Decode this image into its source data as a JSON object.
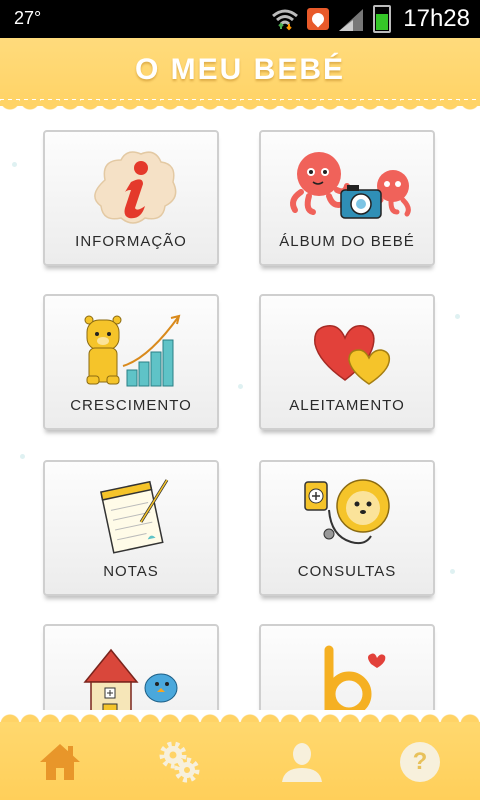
{
  "status_bar": {
    "temperature": "27°",
    "time": "17h28",
    "icons": [
      "wifi-icon",
      "notification-icon",
      "signal-icon",
      "battery-icon"
    ]
  },
  "header": {
    "title": "O MEU BEBÉ"
  },
  "tiles": [
    {
      "label": "INFORMAÇÃO",
      "icon": "info-icon"
    },
    {
      "label": "ÁLBUM DO BEBÉ",
      "icon": "octopus-camera-icon"
    },
    {
      "label": "CRESCIMENTO",
      "icon": "growth-chart-icon"
    },
    {
      "label": "ALEITAMENTO",
      "icon": "hearts-icon"
    },
    {
      "label": "NOTAS",
      "icon": "notepad-icon"
    },
    {
      "label": "CONSULTAS",
      "icon": "lion-doctor-icon"
    },
    {
      "label": "",
      "icon": "house-bird-icon"
    },
    {
      "label": "",
      "icon": "b-logo-icon"
    }
  ],
  "bottom_nav": [
    {
      "name": "home",
      "icon": "home-icon"
    },
    {
      "name": "settings",
      "icon": "gears-icon"
    },
    {
      "name": "profile",
      "icon": "user-icon"
    },
    {
      "name": "help",
      "icon": "help-icon",
      "label": "?"
    }
  ],
  "colors": {
    "header": "#ffd366",
    "accent_orange": "#e8962a",
    "tile_border": "#cfcfcf"
  }
}
